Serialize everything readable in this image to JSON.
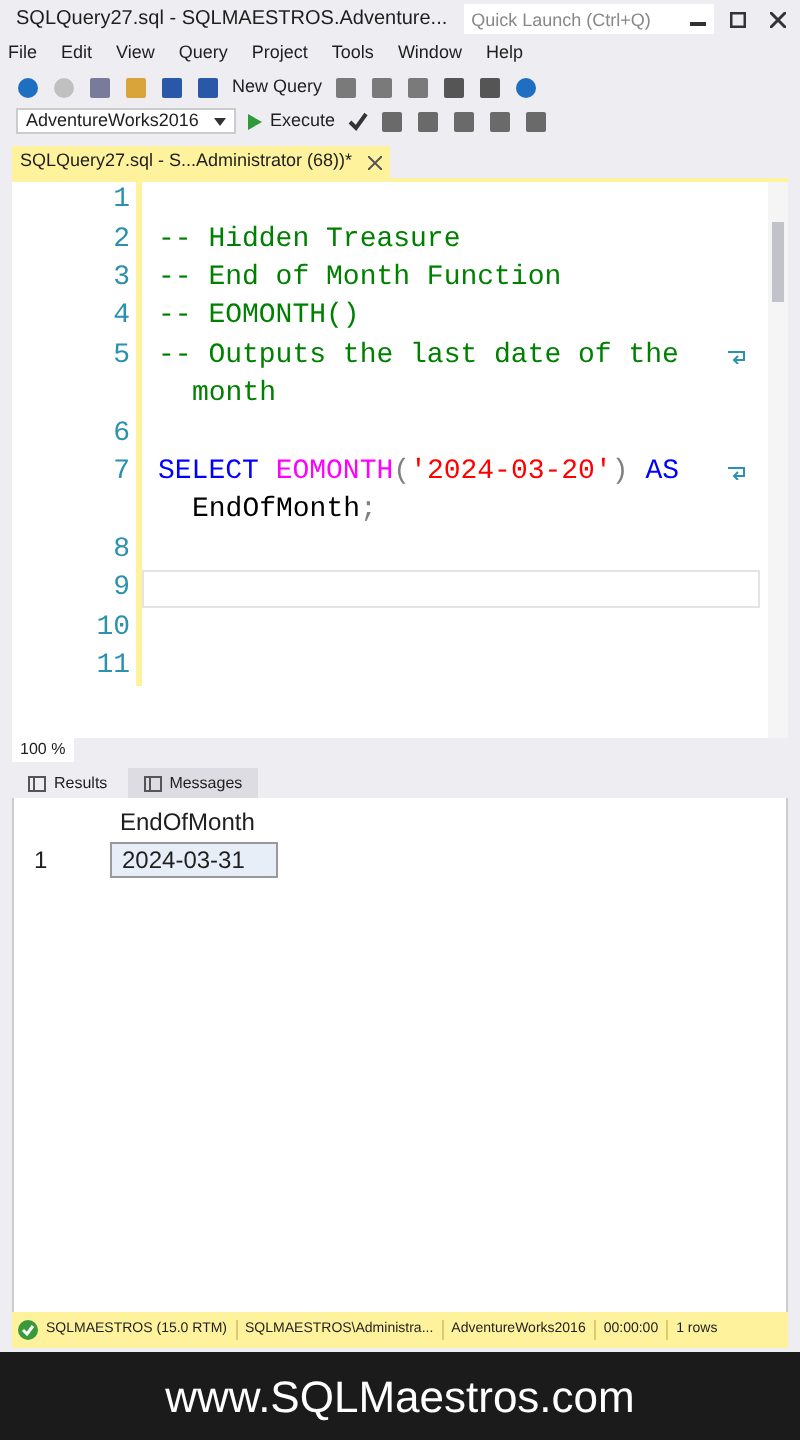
{
  "window": {
    "title": "SQLQuery27.sql - SQLMAESTROS.Adventure...",
    "quick_launch": {
      "placeholder": "Quick Launch (Ctrl+Q)"
    }
  },
  "menu": [
    "File",
    "Edit",
    "View",
    "Query",
    "Project",
    "Tools",
    "Window",
    "Help"
  ],
  "toolbar": {
    "new_query": "New Query",
    "database": "AdventureWorks2016",
    "execute": "Execute"
  },
  "document_tab": {
    "label": "SQLQuery27.sql - S...Administrator (68))*",
    "selected": true
  },
  "editor": {
    "lines": [
      {
        "number": "1",
        "current": false,
        "rows": [
          []
        ]
      },
      {
        "number": "2",
        "current": false,
        "rows": [
          [
            {
              "kind": "comment",
              "text": "-- Hidden Treasure"
            }
          ]
        ]
      },
      {
        "number": "3",
        "current": false,
        "rows": [
          [
            {
              "kind": "comment",
              "text": "-- End of Month Function"
            }
          ]
        ]
      },
      {
        "number": "4",
        "current": false,
        "rows": [
          [
            {
              "kind": "comment",
              "text": "-- EOMONTH()"
            }
          ]
        ]
      },
      {
        "number": "5",
        "current": false,
        "rows": [
          [
            {
              "kind": "comment",
              "text": "-- Outputs the last date of the"
            }
          ],
          [
            {
              "kind": "comment",
              "text": "month"
            }
          ]
        ]
      },
      {
        "number": "6",
        "current": false,
        "rows": [
          []
        ]
      },
      {
        "number": "7",
        "current": false,
        "rows": [
          [
            {
              "kind": "keyword",
              "text": "SELECT"
            },
            {
              "kind": "plain",
              "text": " "
            },
            {
              "kind": "function",
              "text": "EOMONTH"
            },
            {
              "kind": "operator",
              "text": "("
            },
            {
              "kind": "string",
              "text": "'2024-03-20'"
            },
            {
              "kind": "operator",
              "text": ")"
            },
            {
              "kind": "plain",
              "text": " "
            },
            {
              "kind": "keyword",
              "text": "AS"
            }
          ],
          [
            {
              "kind": "plain",
              "text": "EndOfMonth"
            },
            {
              "kind": "operator",
              "text": ";"
            }
          ]
        ]
      },
      {
        "number": "8",
        "current": false,
        "rows": [
          []
        ]
      },
      {
        "number": "9",
        "current": true,
        "rows": [
          []
        ]
      },
      {
        "number": "10",
        "current": false,
        "rows": [
          []
        ]
      },
      {
        "number": "11",
        "current": false,
        "rows": [
          []
        ]
      }
    ],
    "zoom": "100 %"
  },
  "result_tabs": [
    {
      "label": "Results",
      "selected": true
    },
    {
      "label": "Messages",
      "selected": false
    }
  ],
  "results": {
    "columns": [
      "EndOfMonth"
    ],
    "rows": [
      {
        "number": "1",
        "cells": [
          "2024-03-31"
        ]
      }
    ]
  },
  "status_bar": {
    "ok": true,
    "items": [
      "SQLMAESTROS (15.0 RTM)",
      "SQLMAESTROS\\Administra...",
      "AdventureWorks2016",
      "00:00:00",
      "1 rows"
    ]
  },
  "footer": "www.SQLMaestros.com"
}
